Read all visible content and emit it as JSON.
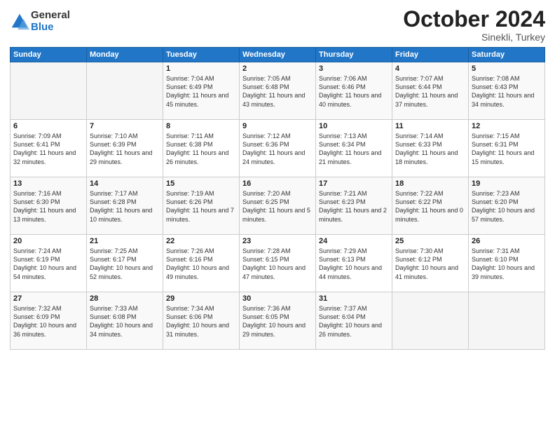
{
  "logo": {
    "general": "General",
    "blue": "Blue"
  },
  "title": "October 2024",
  "location": "Sinekli, Turkey",
  "days_of_week": [
    "Sunday",
    "Monday",
    "Tuesday",
    "Wednesday",
    "Thursday",
    "Friday",
    "Saturday"
  ],
  "weeks": [
    [
      {
        "day": "",
        "sunrise": "",
        "sunset": "",
        "daylight": ""
      },
      {
        "day": "",
        "sunrise": "",
        "sunset": "",
        "daylight": ""
      },
      {
        "day": "1",
        "sunrise": "Sunrise: 7:04 AM",
        "sunset": "Sunset: 6:49 PM",
        "daylight": "Daylight: 11 hours and 45 minutes."
      },
      {
        "day": "2",
        "sunrise": "Sunrise: 7:05 AM",
        "sunset": "Sunset: 6:48 PM",
        "daylight": "Daylight: 11 hours and 43 minutes."
      },
      {
        "day": "3",
        "sunrise": "Sunrise: 7:06 AM",
        "sunset": "Sunset: 6:46 PM",
        "daylight": "Daylight: 11 hours and 40 minutes."
      },
      {
        "day": "4",
        "sunrise": "Sunrise: 7:07 AM",
        "sunset": "Sunset: 6:44 PM",
        "daylight": "Daylight: 11 hours and 37 minutes."
      },
      {
        "day": "5",
        "sunrise": "Sunrise: 7:08 AM",
        "sunset": "Sunset: 6:43 PM",
        "daylight": "Daylight: 11 hours and 34 minutes."
      }
    ],
    [
      {
        "day": "6",
        "sunrise": "Sunrise: 7:09 AM",
        "sunset": "Sunset: 6:41 PM",
        "daylight": "Daylight: 11 hours and 32 minutes."
      },
      {
        "day": "7",
        "sunrise": "Sunrise: 7:10 AM",
        "sunset": "Sunset: 6:39 PM",
        "daylight": "Daylight: 11 hours and 29 minutes."
      },
      {
        "day": "8",
        "sunrise": "Sunrise: 7:11 AM",
        "sunset": "Sunset: 6:38 PM",
        "daylight": "Daylight: 11 hours and 26 minutes."
      },
      {
        "day": "9",
        "sunrise": "Sunrise: 7:12 AM",
        "sunset": "Sunset: 6:36 PM",
        "daylight": "Daylight: 11 hours and 24 minutes."
      },
      {
        "day": "10",
        "sunrise": "Sunrise: 7:13 AM",
        "sunset": "Sunset: 6:34 PM",
        "daylight": "Daylight: 11 hours and 21 minutes."
      },
      {
        "day": "11",
        "sunrise": "Sunrise: 7:14 AM",
        "sunset": "Sunset: 6:33 PM",
        "daylight": "Daylight: 11 hours and 18 minutes."
      },
      {
        "day": "12",
        "sunrise": "Sunrise: 7:15 AM",
        "sunset": "Sunset: 6:31 PM",
        "daylight": "Daylight: 11 hours and 15 minutes."
      }
    ],
    [
      {
        "day": "13",
        "sunrise": "Sunrise: 7:16 AM",
        "sunset": "Sunset: 6:30 PM",
        "daylight": "Daylight: 11 hours and 13 minutes."
      },
      {
        "day": "14",
        "sunrise": "Sunrise: 7:17 AM",
        "sunset": "Sunset: 6:28 PM",
        "daylight": "Daylight: 11 hours and 10 minutes."
      },
      {
        "day": "15",
        "sunrise": "Sunrise: 7:19 AM",
        "sunset": "Sunset: 6:26 PM",
        "daylight": "Daylight: 11 hours and 7 minutes."
      },
      {
        "day": "16",
        "sunrise": "Sunrise: 7:20 AM",
        "sunset": "Sunset: 6:25 PM",
        "daylight": "Daylight: 11 hours and 5 minutes."
      },
      {
        "day": "17",
        "sunrise": "Sunrise: 7:21 AM",
        "sunset": "Sunset: 6:23 PM",
        "daylight": "Daylight: 11 hours and 2 minutes."
      },
      {
        "day": "18",
        "sunrise": "Sunrise: 7:22 AM",
        "sunset": "Sunset: 6:22 PM",
        "daylight": "Daylight: 11 hours and 0 minutes."
      },
      {
        "day": "19",
        "sunrise": "Sunrise: 7:23 AM",
        "sunset": "Sunset: 6:20 PM",
        "daylight": "Daylight: 10 hours and 57 minutes."
      }
    ],
    [
      {
        "day": "20",
        "sunrise": "Sunrise: 7:24 AM",
        "sunset": "Sunset: 6:19 PM",
        "daylight": "Daylight: 10 hours and 54 minutes."
      },
      {
        "day": "21",
        "sunrise": "Sunrise: 7:25 AM",
        "sunset": "Sunset: 6:17 PM",
        "daylight": "Daylight: 10 hours and 52 minutes."
      },
      {
        "day": "22",
        "sunrise": "Sunrise: 7:26 AM",
        "sunset": "Sunset: 6:16 PM",
        "daylight": "Daylight: 10 hours and 49 minutes."
      },
      {
        "day": "23",
        "sunrise": "Sunrise: 7:28 AM",
        "sunset": "Sunset: 6:15 PM",
        "daylight": "Daylight: 10 hours and 47 minutes."
      },
      {
        "day": "24",
        "sunrise": "Sunrise: 7:29 AM",
        "sunset": "Sunset: 6:13 PM",
        "daylight": "Daylight: 10 hours and 44 minutes."
      },
      {
        "day": "25",
        "sunrise": "Sunrise: 7:30 AM",
        "sunset": "Sunset: 6:12 PM",
        "daylight": "Daylight: 10 hours and 41 minutes."
      },
      {
        "day": "26",
        "sunrise": "Sunrise: 7:31 AM",
        "sunset": "Sunset: 6:10 PM",
        "daylight": "Daylight: 10 hours and 39 minutes."
      }
    ],
    [
      {
        "day": "27",
        "sunrise": "Sunrise: 7:32 AM",
        "sunset": "Sunset: 6:09 PM",
        "daylight": "Daylight: 10 hours and 36 minutes."
      },
      {
        "day": "28",
        "sunrise": "Sunrise: 7:33 AM",
        "sunset": "Sunset: 6:08 PM",
        "daylight": "Daylight: 10 hours and 34 minutes."
      },
      {
        "day": "29",
        "sunrise": "Sunrise: 7:34 AM",
        "sunset": "Sunset: 6:06 PM",
        "daylight": "Daylight: 10 hours and 31 minutes."
      },
      {
        "day": "30",
        "sunrise": "Sunrise: 7:36 AM",
        "sunset": "Sunset: 6:05 PM",
        "daylight": "Daylight: 10 hours and 29 minutes."
      },
      {
        "day": "31",
        "sunrise": "Sunrise: 7:37 AM",
        "sunset": "Sunset: 6:04 PM",
        "daylight": "Daylight: 10 hours and 26 minutes."
      },
      {
        "day": "",
        "sunrise": "",
        "sunset": "",
        "daylight": ""
      },
      {
        "day": "",
        "sunrise": "",
        "sunset": "",
        "daylight": ""
      }
    ]
  ]
}
